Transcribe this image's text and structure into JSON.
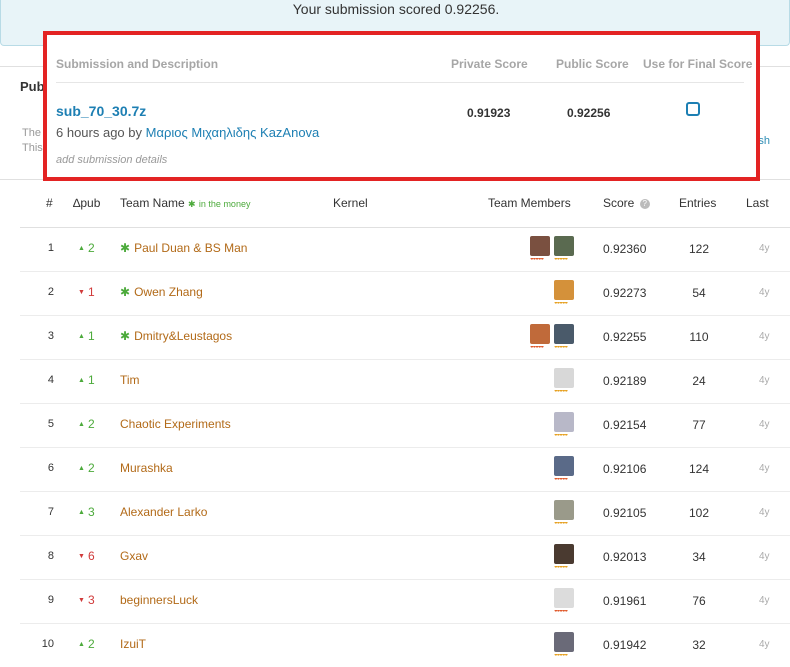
{
  "banner": {
    "text": "Your submission scored 0.92256."
  },
  "background_panel": {
    "tab_label": "Pub",
    "line1": "The",
    "line2": "This",
    "right_link": "sh"
  },
  "popup": {
    "headers": {
      "desc": "Submission and Description",
      "private": "Private Score",
      "public": "Public Score",
      "final": "Use for Final Score"
    },
    "submission": {
      "name": "sub_70_30.7z",
      "time_prefix": "6 hours ago by ",
      "author": "Μαριος Μιχαηλιδης KazAnova",
      "details_placeholder": "add submission details",
      "private_score": "0.91923",
      "public_score": "0.92256",
      "use_for_final": false
    }
  },
  "leaderboard": {
    "headers": {
      "rank": "#",
      "delta": "∆pub",
      "team": "Team Name",
      "money_star": "✱",
      "money": "in the money",
      "kernel": "Kernel",
      "members": "Team Members",
      "score": "Score",
      "info": "?",
      "entries": "Entries",
      "last": "Last"
    },
    "rows": [
      {
        "rank": "1",
        "dir": "up",
        "delta": "2",
        "in_money": true,
        "team": "Paul Duan & BS Man",
        "avatars": [
          "#7a5040",
          "#5a6a50"
        ],
        "tiers": [
          "#e05a2c",
          "#e6a020"
        ],
        "score": "0.92360",
        "entries": "122",
        "last": "4y"
      },
      {
        "rank": "2",
        "dir": "down",
        "delta": "1",
        "in_money": true,
        "team": "Owen Zhang",
        "avatars": [
          "#d4913a"
        ],
        "tiers": [
          "#e6a020"
        ],
        "score": "0.92273",
        "entries": "54",
        "last": "4y"
      },
      {
        "rank": "3",
        "dir": "up",
        "delta": "1",
        "in_money": true,
        "team": "Dmitry&Leustagos",
        "avatars": [
          "#c06a3a",
          "#4a5a6a"
        ],
        "tiers": [
          "#e05a2c",
          "#e6a020"
        ],
        "score": "0.92255",
        "entries": "110",
        "last": "4y"
      },
      {
        "rank": "4",
        "dir": "up",
        "delta": "1",
        "in_money": false,
        "team": "Tim",
        "avatars": [
          "#d8d8d8"
        ],
        "tiers": [
          "#e6a020"
        ],
        "score": "0.92189",
        "entries": "24",
        "last": "4y"
      },
      {
        "rank": "5",
        "dir": "up",
        "delta": "2",
        "in_money": false,
        "team": "Chaotic Experiments",
        "avatars": [
          "#b8b8c8"
        ],
        "tiers": [
          "#e6a020"
        ],
        "score": "0.92154",
        "entries": "77",
        "last": "4y"
      },
      {
        "rank": "6",
        "dir": "up",
        "delta": "2",
        "in_money": false,
        "team": "Murashka",
        "avatars": [
          "#5a6a88"
        ],
        "tiers": [
          "#e05a2c"
        ],
        "score": "0.92106",
        "entries": "124",
        "last": "4y"
      },
      {
        "rank": "7",
        "dir": "up",
        "delta": "3",
        "in_money": false,
        "team": "Alexander Larko",
        "avatars": [
          "#9a9a8a"
        ],
        "tiers": [
          "#e6a020"
        ],
        "score": "0.92105",
        "entries": "102",
        "last": "4y"
      },
      {
        "rank": "8",
        "dir": "down",
        "delta": "6",
        "in_money": false,
        "team": "Gxav",
        "avatars": [
          "#4a3a30"
        ],
        "tiers": [
          "#e6a020"
        ],
        "score": "0.92013",
        "entries": "34",
        "last": "4y"
      },
      {
        "rank": "9",
        "dir": "down",
        "delta": "3",
        "in_money": false,
        "team": "beginnersLuck",
        "avatars": [
          "#dcdcdc"
        ],
        "tiers": [
          "#e05a2c"
        ],
        "score": "0.91961",
        "entries": "76",
        "last": "4y"
      },
      {
        "rank": "10",
        "dir": "up",
        "delta": "2",
        "in_money": false,
        "team": "IzuiT",
        "avatars": [
          "#6a6a78"
        ],
        "tiers": [
          "#e6a020"
        ],
        "score": "0.91942",
        "entries": "32",
        "last": "4y"
      }
    ]
  },
  "colors": {
    "link": "#1d7fb3",
    "team": "#b26a18",
    "up": "#4caa3b",
    "down": "#d03a3a",
    "highlight": "#e32323"
  }
}
